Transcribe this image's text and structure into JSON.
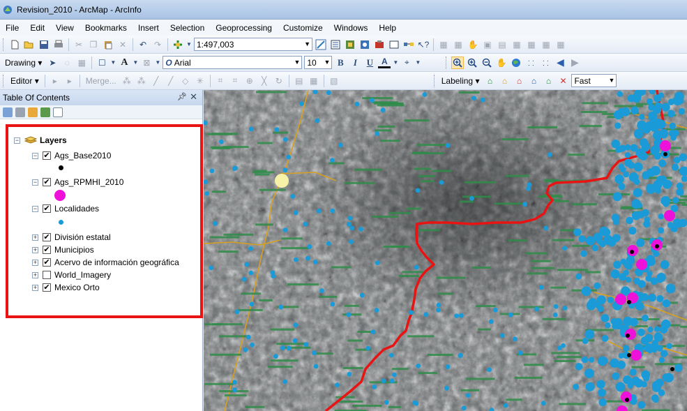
{
  "window": {
    "title": "Revision_2010 - ArcMap - ArcInfo"
  },
  "menu": {
    "items": [
      "File",
      "Edit",
      "View",
      "Bookmarks",
      "Insert",
      "Selection",
      "Geoprocessing",
      "Customize",
      "Windows",
      "Help"
    ]
  },
  "standard_toolbar": {
    "scale": "1:497,003"
  },
  "draw_toolbar": {
    "drawing_label": "Drawing",
    "font_name": "Arial",
    "font_size": "10",
    "bold": "B",
    "italic": "I",
    "underline": "U",
    "font_color": "A"
  },
  "editor_toolbar": {
    "editor_label": "Editor",
    "merge_label": "Merge...",
    "labeling_label": "Labeling",
    "quality_value": "Fast"
  },
  "toc": {
    "title": "Table Of Contents",
    "root_label": "Layers",
    "layers": [
      {
        "name": "Ags_Base2010",
        "checked": true,
        "expanded": true,
        "symbol_color": "#000000"
      },
      {
        "name": "Ags_RPMHI_2010",
        "checked": true,
        "expanded": true,
        "symbol_color": "#ee11d9"
      },
      {
        "name": "Localidades",
        "checked": true,
        "expanded": true,
        "symbol_color": "#1a9bd8"
      },
      {
        "name": "División estatal",
        "checked": true,
        "expanded": false
      },
      {
        "name": "Municipios",
        "checked": true,
        "expanded": false
      },
      {
        "name": "Acervo de información geográfica",
        "checked": true,
        "expanded": false
      },
      {
        "name": "World_Imagery",
        "checked": false,
        "expanded": false
      },
      {
        "name": "Mexico Orto",
        "checked": true,
        "expanded": false
      }
    ]
  },
  "colors": {
    "highlight": "#e81414",
    "boundary": "#e81414",
    "roads": "#d8a020",
    "locality": "#1a9bd8",
    "rpmhi": "#ee11d9",
    "label": "#2f8c4a"
  },
  "icons": [
    "arcmap-icon",
    "new-doc-icon",
    "open-icon",
    "save-icon",
    "print-icon",
    "cut-icon",
    "copy-icon",
    "paste-icon",
    "delete-icon",
    "undo-icon",
    "redo-icon",
    "add-data-icon",
    "pin-icon",
    "close-icon",
    "layers-icon",
    "zoom-in-icon",
    "zoom-out-icon",
    "pan-icon",
    "globe-icon",
    "back-icon",
    "forward-icon"
  ]
}
